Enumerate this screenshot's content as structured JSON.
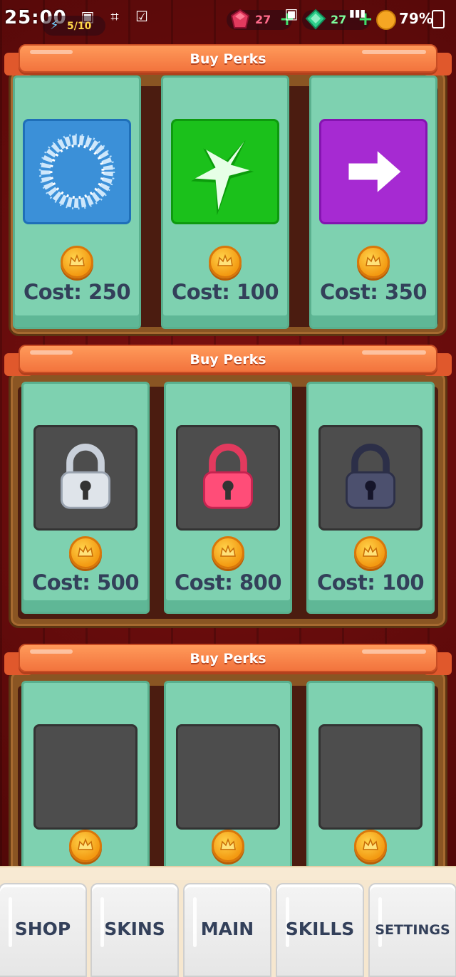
{
  "status_bar": {
    "time": "25:00",
    "battery_percent": "79%"
  },
  "hud": {
    "gems": "27",
    "diamonds": "27",
    "energy": "5/10"
  },
  "boards": [
    {
      "title": "Buy Perks",
      "cards": [
        {
          "icon": "frost-ring-icon",
          "cost": "Cost: 250",
          "locked": false
        },
        {
          "icon": "shuriken-star-icon",
          "cost": "Cost: 100",
          "locked": false
        },
        {
          "icon": "arrow-right-icon",
          "cost": "Cost: 350",
          "locked": false
        }
      ]
    },
    {
      "title": "Buy Perks",
      "cards": [
        {
          "icon": "silver-lock-icon",
          "cost": "Cost: 500",
          "locked": true
        },
        {
          "icon": "pink-lock-icon",
          "cost": "Cost: 800",
          "locked": true
        },
        {
          "icon": "dark-lock-icon",
          "cost": "Cost: 100",
          "locked": true
        }
      ]
    },
    {
      "title": "Buy Perks",
      "cards": [
        {
          "icon": "empty-slot",
          "cost": "",
          "locked": true
        },
        {
          "icon": "empty-slot",
          "cost": "",
          "locked": true
        },
        {
          "icon": "empty-slot",
          "cost": "",
          "locked": true
        }
      ]
    }
  ],
  "nav": {
    "shop": "SHOP",
    "skins": "SKINS",
    "main": "MAIN",
    "skills": "SKILLS",
    "settings": "SETTINGS"
  },
  "colors": {
    "card": "#7ed1b0",
    "banner": "#f2733d",
    "cost_text": "#33405a",
    "coin": "#f39a12"
  }
}
